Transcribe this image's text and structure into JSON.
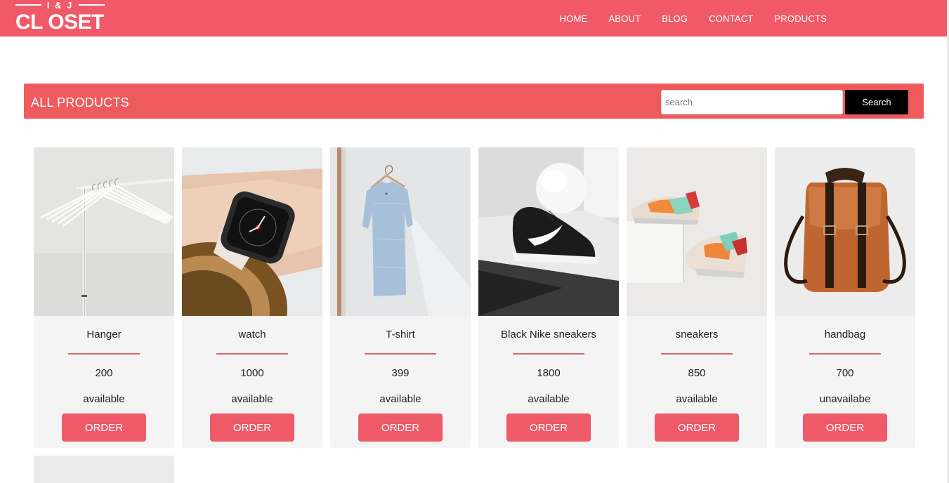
{
  "logo": {
    "tag": "I & J",
    "brand": "CL OSET"
  },
  "nav": {
    "home": "HOME",
    "about": "ABOUT",
    "blog": "BLOG",
    "contact": "CONTACT",
    "products": "PRODUCTS"
  },
  "banner": {
    "title": "ALL PRODUCTS",
    "search_placeholder": "search",
    "search_value": "",
    "search_label": "Search"
  },
  "colors": {
    "header": "#f05a68",
    "banner": "#ef5a5c",
    "order_button": "#ef5a68",
    "divider": "#e0606c",
    "card_bg": "#f4f4f4"
  },
  "products": [
    {
      "name": "Hanger",
      "price": "200",
      "status": "available",
      "order_label": "ORDER",
      "image": "clothes-hangers-photo"
    },
    {
      "name": "watch",
      "price": "1000",
      "status": "available",
      "order_label": "ORDER",
      "image": "smartwatch-photo"
    },
    {
      "name": "T-shirt",
      "price": "399",
      "status": "available",
      "order_label": "ORDER",
      "image": "tshirt-on-hanger-photo"
    },
    {
      "name": "Black Nike sneakers",
      "price": "1800",
      "status": "available",
      "order_label": "ORDER",
      "image": "black-sneaker-photo"
    },
    {
      "name": "sneakers",
      "price": "850",
      "status": "available",
      "order_label": "ORDER",
      "image": "colorful-sneakers-photo"
    },
    {
      "name": "handbag",
      "price": "700",
      "status": "unavailabe",
      "order_label": "ORDER",
      "image": "leather-backpack-photo"
    }
  ]
}
